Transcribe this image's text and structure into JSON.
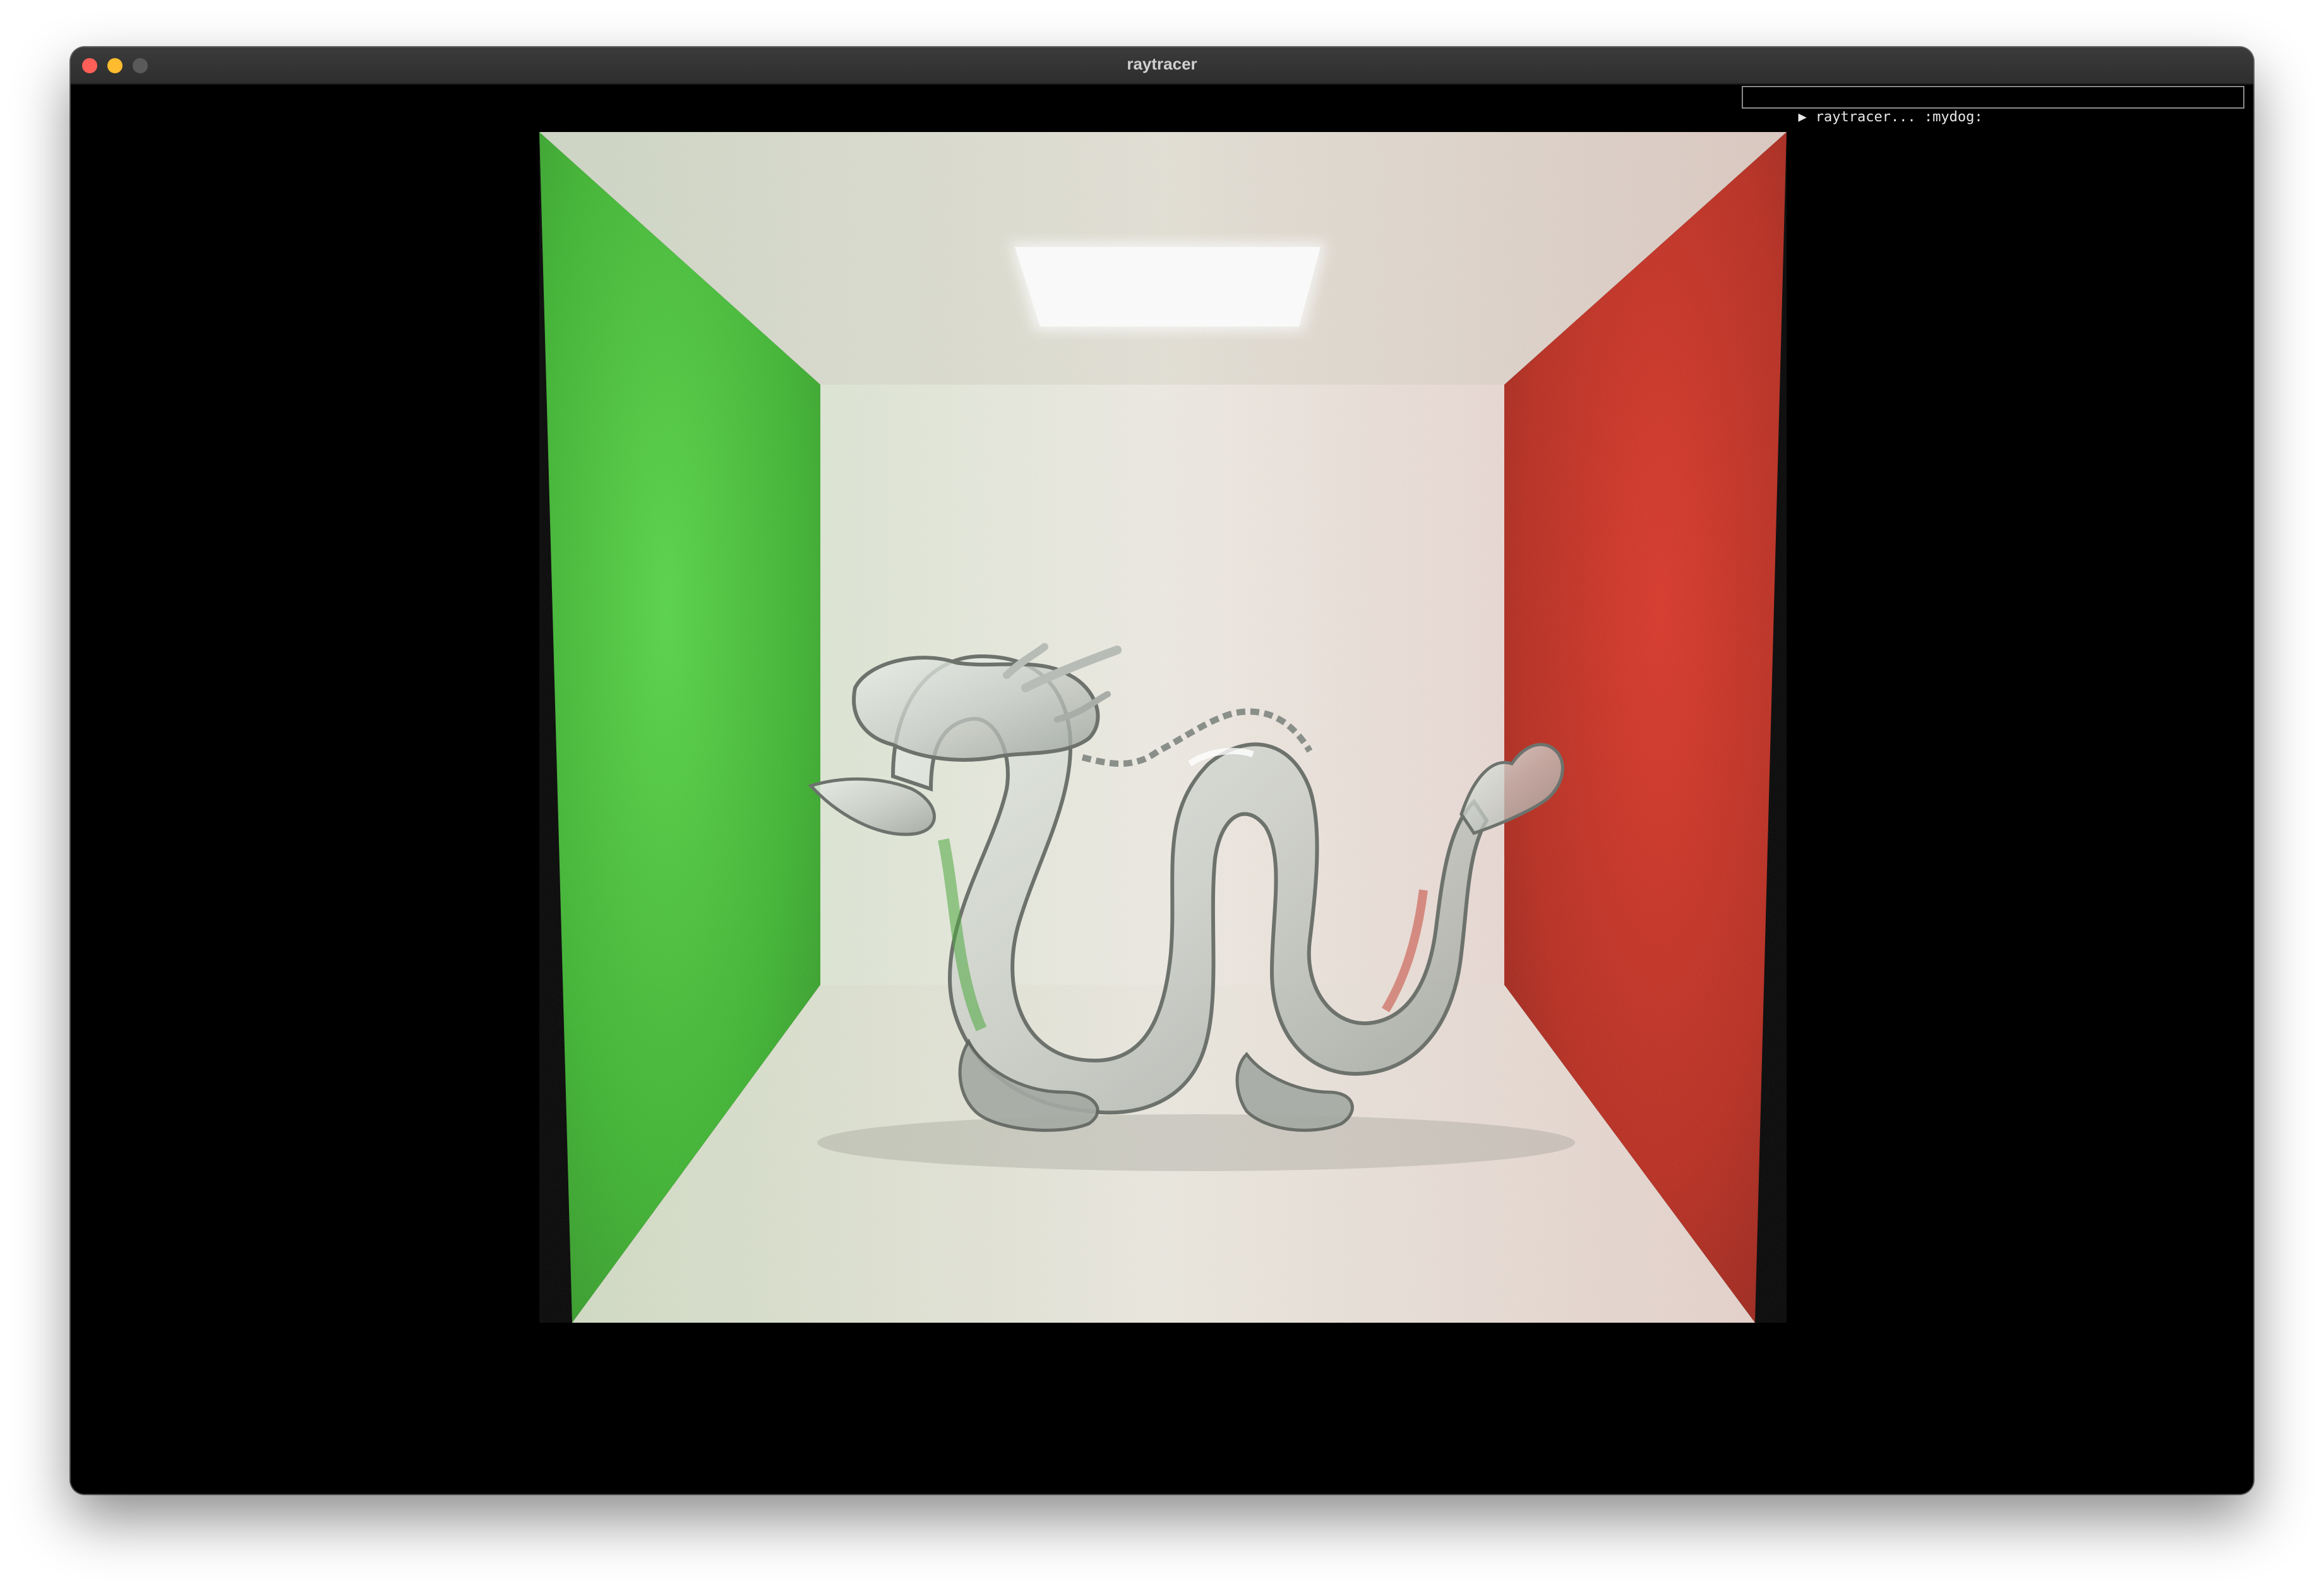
{
  "window": {
    "title": "raytracer"
  },
  "console": {
    "prompt_icon": "play-triangle",
    "text": "raytracer... :mydog:"
  },
  "scene": {
    "colors": {
      "left_wall": "#3fbf32",
      "right_wall": "#c42a1e",
      "back_wall": "#ebe6dc",
      "light": "#ffffff"
    }
  }
}
